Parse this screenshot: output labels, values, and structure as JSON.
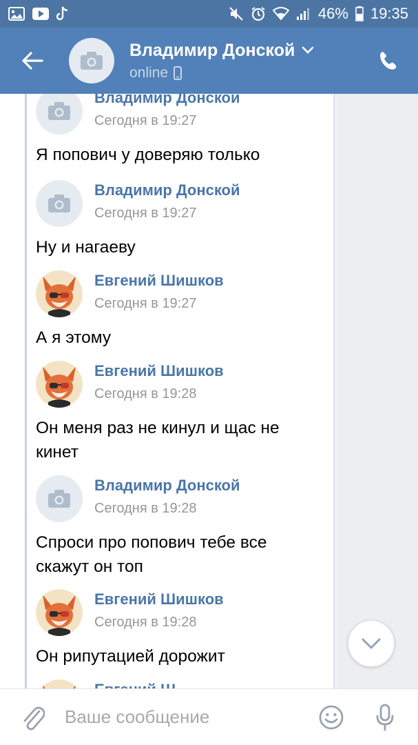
{
  "status_bar": {
    "battery": "46%",
    "time": "19:35",
    "icons": [
      "gallery-icon",
      "youtube-icon",
      "tiktok-icon",
      "mute-icon",
      "alarm-icon",
      "wifi-icon",
      "signal-icon",
      "battery-icon"
    ]
  },
  "header": {
    "name": "Владимир Донской",
    "status": "online",
    "icons": [
      "back-arrow-icon",
      "camera-icon",
      "chevron-down-icon",
      "mobile-icon",
      "phone-icon"
    ]
  },
  "messages": [
    {
      "author": "Владимир Донской",
      "time": "Сегодня в 19:27",
      "text": "",
      "avatar": "camera-placeholder"
    },
    {
      "author": "Владимир Донской",
      "time": "Сегодня в 19:27",
      "text": "Я попович у доверяю только",
      "avatar": "camera-placeholder"
    },
    {
      "author": "Владимир Донской",
      "time": "Сегодня в 19:27",
      "text": "Ну и нагаеву",
      "avatar": "camera-placeholder"
    },
    {
      "author": "Евгений Шишков",
      "time": "Сегодня в 19:27",
      "text": "А я этому",
      "avatar": "fox"
    },
    {
      "author": "Евгений Шишков",
      "time": "Сегодня в 19:28",
      "text": "Он меня раз не кинул и щас не кинет",
      "avatar": "fox"
    },
    {
      "author": "Владимир Донской",
      "time": "Сегодня в 19:28",
      "text": "Спроси про попович тебе все скажут он топ",
      "avatar": "camera-placeholder"
    },
    {
      "author": "Евгений Шишков",
      "time": "Сегодня в 19:28",
      "text": "Он рипутацией дорожит",
      "avatar": "fox"
    },
    {
      "author": "Евгений Ш",
      "time": "",
      "text": "",
      "avatar": "fox"
    }
  ],
  "input": {
    "placeholder": "Ваше сообщение",
    "value": ""
  },
  "colors": {
    "header": "#5181b8",
    "status_bar": "#4c75a3",
    "link": "#4a76a8",
    "chat_bg": "#edeef0"
  }
}
